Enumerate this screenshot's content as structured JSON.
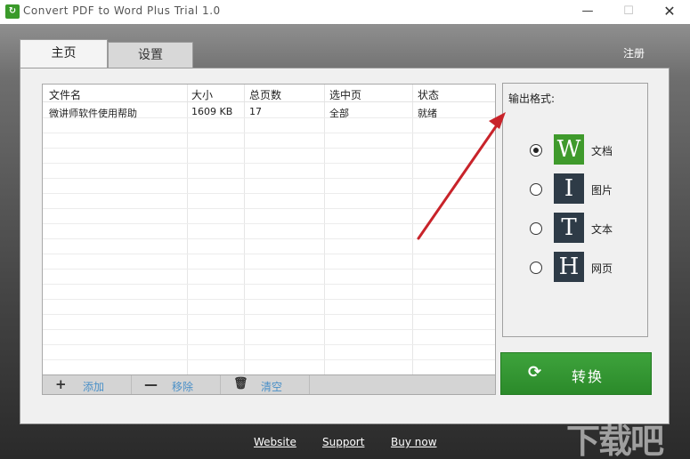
{
  "window": {
    "title": "Convert PDF to Word Plus Trial 1.0",
    "min_glyph": "—",
    "max_glyph": "☐",
    "close_glyph": "✕"
  },
  "tabs": [
    {
      "label": "主页",
      "active": true
    },
    {
      "label": "设置",
      "active": false
    }
  ],
  "register_label": "注册",
  "table": {
    "columns": [
      "文件名",
      "大小",
      "总页数",
      "选中页",
      "状态"
    ],
    "rows": [
      {
        "name": "微讲师软件使用帮助",
        "size": "1609 KB",
        "pages": "17",
        "selected": "全部",
        "status": "就绪"
      }
    ]
  },
  "toolbar": {
    "add": {
      "icon": "plus-icon",
      "glyph": "+",
      "label": "添加"
    },
    "remove": {
      "icon": "minus-icon",
      "glyph": "—",
      "label": "移除"
    },
    "clear": {
      "icon": "trash-icon",
      "glyph": "🗑",
      "label": "清空"
    }
  },
  "output_format": {
    "title": "输出格式:",
    "options": [
      {
        "letter": "W",
        "label": "文档",
        "selected": true,
        "color": "#3f9a2c"
      },
      {
        "letter": "I",
        "label": "图片",
        "selected": false,
        "color": "#2e3b47"
      },
      {
        "letter": "T",
        "label": "文本",
        "selected": false,
        "color": "#2e3b47"
      },
      {
        "letter": "H",
        "label": "网页",
        "selected": false,
        "color": "#2e3b47"
      }
    ]
  },
  "convert": {
    "label": "转换",
    "icon": "refresh-icon",
    "glyph": "⟳",
    "color": "#2f8f2d"
  },
  "footer": {
    "website": "Website",
    "support": "Support",
    "buy": "Buy now"
  },
  "watermark": "下载吧",
  "annotation_color": "#c8232a"
}
